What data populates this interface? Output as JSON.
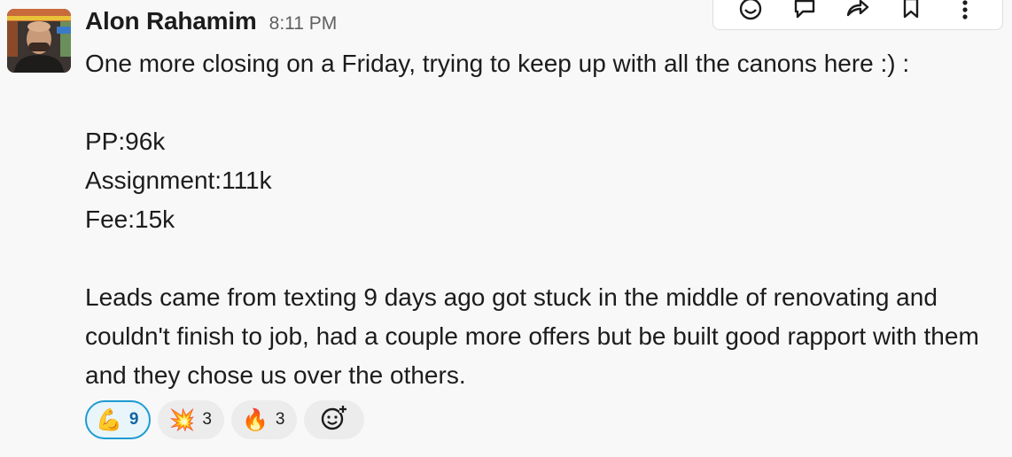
{
  "message": {
    "author": "Alon Rahamim",
    "timestamp": "8:11 PM",
    "lines": [
      "One more closing on a Friday, trying to keep up with all the canons here :) :",
      "PP:96k",
      "Assignment:111k",
      "Fee:15k",
      "Leads came from texting 9 days ago got stuck in the middle of renovating and couldn't finish to job, had a couple more offers but be built good rapport with them and they chose us over the others."
    ]
  },
  "reactions": [
    {
      "emoji": "💪",
      "icon": "flexed-biceps-icon",
      "count": "9",
      "active": true
    },
    {
      "emoji": "💥",
      "icon": "collision-icon",
      "count": "3",
      "active": false
    },
    {
      "emoji": "🔥",
      "icon": "fire-icon",
      "count": "3",
      "active": false
    }
  ],
  "colors": {
    "background": "#f8f8f8",
    "active_border": "#1d9bd1",
    "active_bg": "#e8f5fa",
    "pill_bg": "#ececec"
  },
  "toolbar_icons": [
    "emoji-icon",
    "reply-thread-icon",
    "share-icon",
    "bookmark-icon",
    "more-actions-icon"
  ]
}
